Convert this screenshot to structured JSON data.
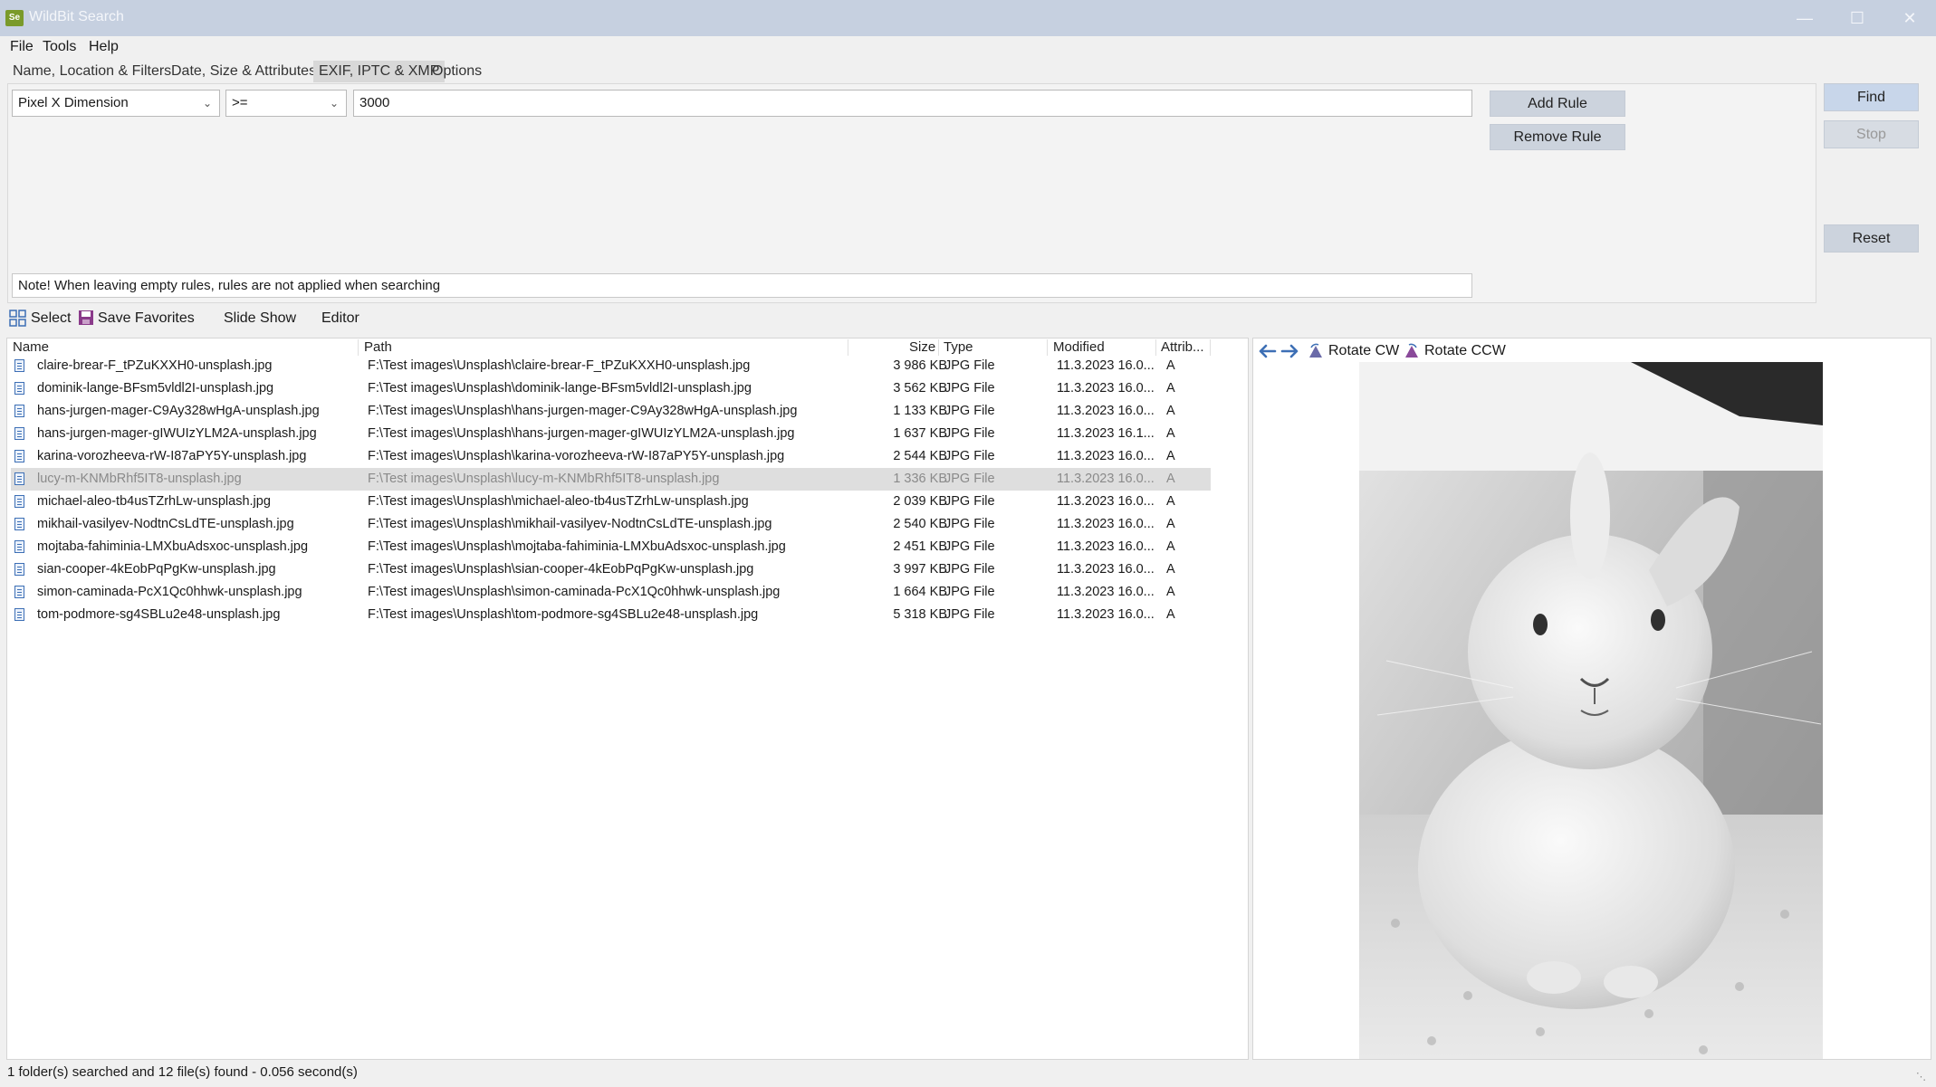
{
  "window": {
    "title": "WildBit Search",
    "app_icon_text": "Se",
    "minimize": "—",
    "maximize": "☐",
    "close": "✕"
  },
  "menu": [
    "File",
    "Tools",
    "Help"
  ],
  "tabs": [
    "Name, Location & Filters",
    "Date, Size & Attributes",
    "EXIF, IPTC & XMP",
    "Options"
  ],
  "active_tab": "EXIF, IPTC & XMP",
  "rule": {
    "field": "Pixel X Dimension",
    "operator": ">=",
    "value": "3000"
  },
  "buttons": {
    "add_rule": "Add Rule",
    "remove_rule": "Remove Rule",
    "find": "Find",
    "stop": "Stop",
    "reset": "Reset"
  },
  "note": "Note! When leaving empty rules, rules are not applied when searching",
  "toolbar": {
    "select": "Select",
    "save_favorites": "Save Favorites",
    "slide_show": "Slide Show",
    "editor": "Editor"
  },
  "columns": [
    "Name",
    "Path",
    "Size",
    "Type",
    "Modified",
    "Attrib..."
  ],
  "files": [
    {
      "name": "claire-brear-F_tPZuKXXH0-unsplash.jpg",
      "path": "F:\\Test images\\Unsplash\\claire-brear-F_tPZuKXXH0-unsplash.jpg",
      "size": "3 986 KB",
      "type": "JPG File",
      "modified": "11.3.2023 16.0...",
      "attrib": "A"
    },
    {
      "name": "dominik-lange-BFsm5vldl2I-unsplash.jpg",
      "path": "F:\\Test images\\Unsplash\\dominik-lange-BFsm5vldl2I-unsplash.jpg",
      "size": "3 562 KB",
      "type": "JPG File",
      "modified": "11.3.2023 16.0...",
      "attrib": "A"
    },
    {
      "name": "hans-jurgen-mager-C9Ay328wHgA-unsplash.jpg",
      "path": "F:\\Test images\\Unsplash\\hans-jurgen-mager-C9Ay328wHgA-unsplash.jpg",
      "size": "1 133 KB",
      "type": "JPG File",
      "modified": "11.3.2023 16.0...",
      "attrib": "A"
    },
    {
      "name": "hans-jurgen-mager-gIWUIzYLM2A-unsplash.jpg",
      "path": "F:\\Test images\\Unsplash\\hans-jurgen-mager-gIWUIzYLM2A-unsplash.jpg",
      "size": "1 637 KB",
      "type": "JPG File",
      "modified": "11.3.2023 16.1...",
      "attrib": "A"
    },
    {
      "name": "karina-vorozheeva-rW-I87aPY5Y-unsplash.jpg",
      "path": "F:\\Test images\\Unsplash\\karina-vorozheeva-rW-I87aPY5Y-unsplash.jpg",
      "size": "2 544 KB",
      "type": "JPG File",
      "modified": "11.3.2023 16.0...",
      "attrib": "A"
    },
    {
      "name": "lucy-m-KNMbRhf5IT8-unsplash.jpg",
      "path": "F:\\Test images\\Unsplash\\lucy-m-KNMbRhf5IT8-unsplash.jpg",
      "size": "1 336 KB",
      "type": "JPG File",
      "modified": "11.3.2023 16.0...",
      "attrib": "A"
    },
    {
      "name": "michael-aleo-tb4usTZrhLw-unsplash.jpg",
      "path": "F:\\Test images\\Unsplash\\michael-aleo-tb4usTZrhLw-unsplash.jpg",
      "size": "2 039 KB",
      "type": "JPG File",
      "modified": "11.3.2023 16.0...",
      "attrib": "A"
    },
    {
      "name": "mikhail-vasilyev-NodtnCsLdTE-unsplash.jpg",
      "path": "F:\\Test images\\Unsplash\\mikhail-vasilyev-NodtnCsLdTE-unsplash.jpg",
      "size": "2 540 KB",
      "type": "JPG File",
      "modified": "11.3.2023 16.0...",
      "attrib": "A"
    },
    {
      "name": "mojtaba-fahiminia-LMXbuAdsxoc-unsplash.jpg",
      "path": "F:\\Test images\\Unsplash\\mojtaba-fahiminia-LMXbuAdsxoc-unsplash.jpg",
      "size": "2 451 KB",
      "type": "JPG File",
      "modified": "11.3.2023 16.0...",
      "attrib": "A"
    },
    {
      "name": "sian-cooper-4kEobPqPgKw-unsplash.jpg",
      "path": "F:\\Test images\\Unsplash\\sian-cooper-4kEobPqPgKw-unsplash.jpg",
      "size": "3 997 KB",
      "type": "JPG File",
      "modified": "11.3.2023 16.0...",
      "attrib": "A"
    },
    {
      "name": "simon-caminada-PcX1Qc0hhwk-unsplash.jpg",
      "path": "F:\\Test images\\Unsplash\\simon-caminada-PcX1Qc0hhwk-unsplash.jpg",
      "size": "1 664 KB",
      "type": "JPG File",
      "modified": "11.3.2023 16.0...",
      "attrib": "A"
    },
    {
      "name": "tom-podmore-sg4SBLu2e48-unsplash.jpg",
      "path": "F:\\Test images\\Unsplash\\tom-podmore-sg4SBLu2e48-unsplash.jpg",
      "size": "5 318 KB",
      "type": "JPG File",
      "modified": "11.3.2023 16.0...",
      "attrib": "A"
    }
  ],
  "selected_file": "lucy-m-KNMbRhf5IT8-unsplash.jpg",
  "preview": {
    "rotate_cw": "Rotate CW",
    "rotate_ccw": "Rotate CCW"
  },
  "status": "1 folder(s) searched and 12 file(s) found - 0.056 second(s)",
  "colors": {
    "titlebar": "#c6d0e0",
    "button": "#ccd3dd",
    "selected_row": "#dedede",
    "accent_blue": "#3d6fb5"
  }
}
